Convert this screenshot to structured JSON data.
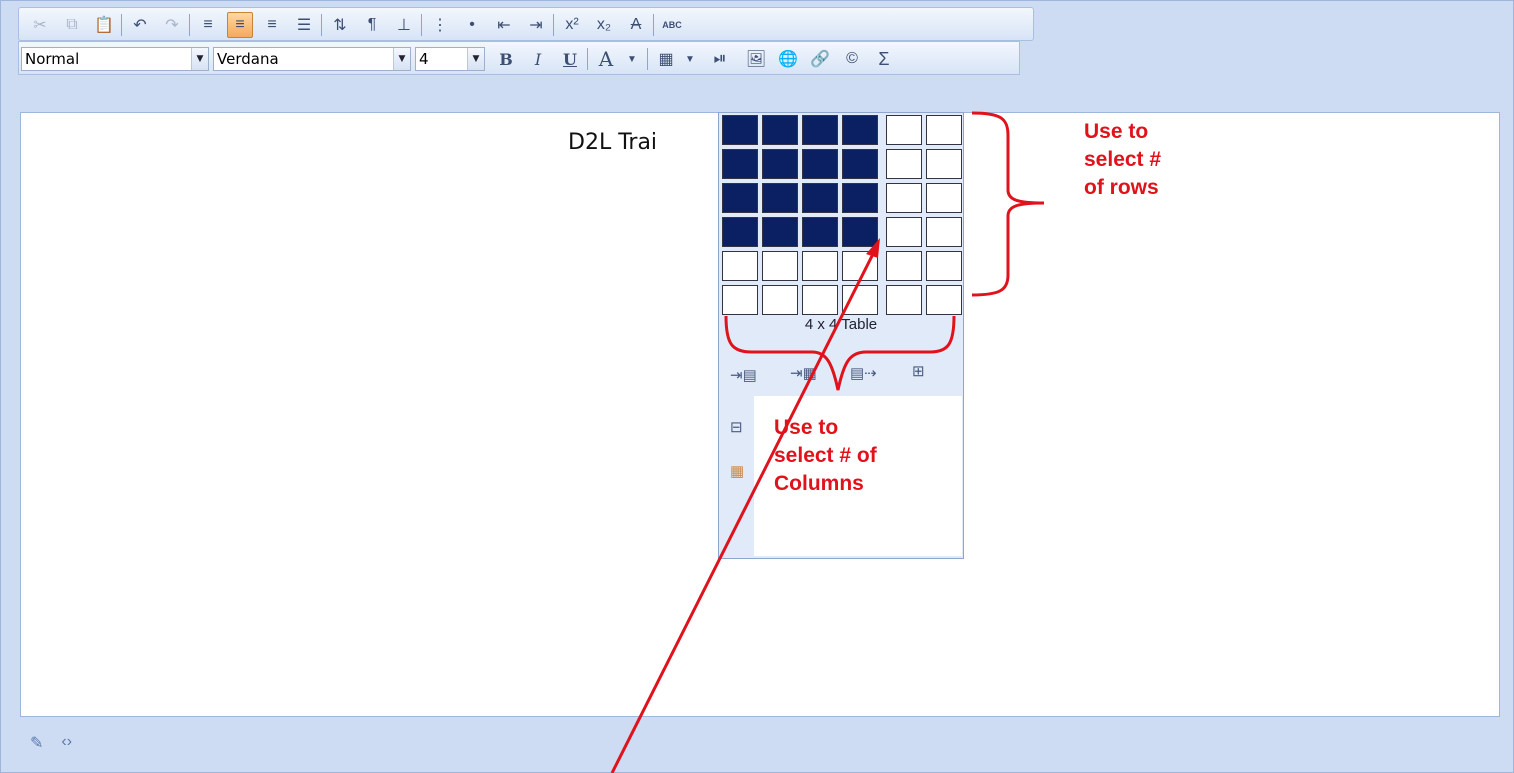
{
  "toolbar": {
    "paragraph_style": "Normal",
    "font_family": "Verdana",
    "font_size": "4",
    "bold_label": "B",
    "italic_label": "I",
    "underline_label": "U",
    "font_color_label": "A",
    "spellcheck_label": "ABC"
  },
  "editor": {
    "text": "D2L Trai"
  },
  "table_picker": {
    "rows_total": 6,
    "cols_total": 6,
    "selected_rows": 4,
    "selected_cols": 4,
    "caption": "4 x 4 Table"
  },
  "annotations": {
    "rows_note": [
      "Use to",
      "select #",
      "of rows"
    ],
    "columns_note": [
      "Use to",
      "select # of",
      "Columns"
    ]
  },
  "colors": {
    "annotation": "#e0121c",
    "selected_cell": "#0b1f63",
    "toolbar_bg": "#cddcf3"
  }
}
